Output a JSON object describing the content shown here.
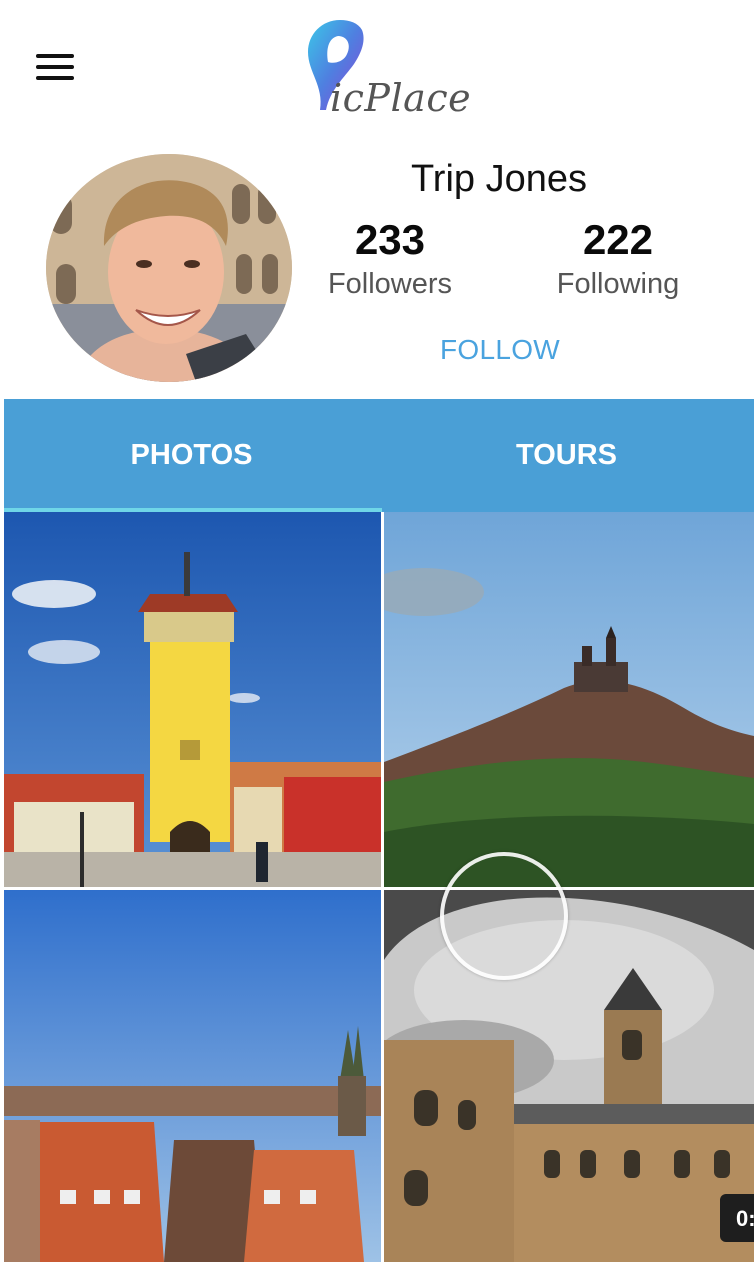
{
  "app": {
    "logo_text": "icPlace"
  },
  "header": {
    "menu_icon": "hamburger-menu-icon"
  },
  "profile": {
    "name": "Trip Jones",
    "followers_count": "233",
    "followers_label": "Followers",
    "following_count": "222",
    "following_label": "Following",
    "follow_label": "FOLLOW"
  },
  "tabs": [
    {
      "label": "PHOTOS",
      "active": true
    },
    {
      "label": "TOURS",
      "active": false
    }
  ],
  "photos": [
    {
      "subject": "yellow medieval tower gate under blue sky"
    },
    {
      "subject": "castle on a forested hill"
    },
    {
      "subject": "city rooftops with church spires"
    },
    {
      "subject": "stone building with clock tower seen through arch"
    }
  ],
  "overlay": {
    "time_badge": "0:"
  },
  "colors": {
    "accent": "#4a9fd6",
    "tab_indicator": "#6fd6e8",
    "follow": "#4aa3df"
  }
}
